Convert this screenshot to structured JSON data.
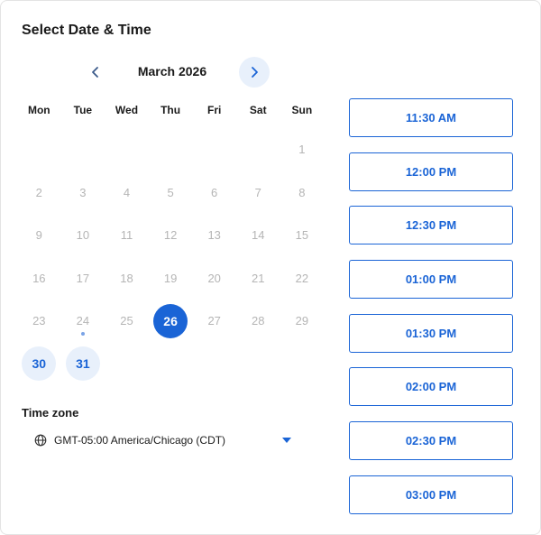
{
  "header": {
    "title": "Select Date & Time"
  },
  "calendar": {
    "month_label": "March 2026",
    "weekdays": [
      "Mon",
      "Tue",
      "Wed",
      "Thu",
      "Fri",
      "Sat",
      "Sun"
    ],
    "leading_blank_days": 6,
    "days": [
      {
        "label": "1",
        "state": "disabled"
      },
      {
        "label": "2",
        "state": "disabled"
      },
      {
        "label": "3",
        "state": "disabled"
      },
      {
        "label": "4",
        "state": "disabled"
      },
      {
        "label": "5",
        "state": "disabled"
      },
      {
        "label": "6",
        "state": "disabled"
      },
      {
        "label": "7",
        "state": "disabled"
      },
      {
        "label": "8",
        "state": "disabled"
      },
      {
        "label": "9",
        "state": "disabled"
      },
      {
        "label": "10",
        "state": "disabled"
      },
      {
        "label": "11",
        "state": "disabled"
      },
      {
        "label": "12",
        "state": "disabled"
      },
      {
        "label": "13",
        "state": "disabled"
      },
      {
        "label": "14",
        "state": "disabled"
      },
      {
        "label": "15",
        "state": "disabled"
      },
      {
        "label": "16",
        "state": "disabled"
      },
      {
        "label": "17",
        "state": "disabled"
      },
      {
        "label": "18",
        "state": "disabled"
      },
      {
        "label": "19",
        "state": "disabled"
      },
      {
        "label": "20",
        "state": "disabled"
      },
      {
        "label": "21",
        "state": "disabled"
      },
      {
        "label": "22",
        "state": "disabled"
      },
      {
        "label": "23",
        "state": "disabled"
      },
      {
        "label": "24",
        "state": "disabled",
        "today": true
      },
      {
        "label": "25",
        "state": "disabled"
      },
      {
        "label": "26",
        "state": "selected"
      },
      {
        "label": "27",
        "state": "disabled"
      },
      {
        "label": "28",
        "state": "disabled"
      },
      {
        "label": "29",
        "state": "disabled"
      },
      {
        "label": "30",
        "state": "available"
      },
      {
        "label": "31",
        "state": "available"
      }
    ]
  },
  "timezone": {
    "label": "Time zone",
    "value": "GMT-05:00 America/Chicago (CDT)"
  },
  "slots": [
    "11:30 AM",
    "12:00 PM",
    "12:30 PM",
    "01:00 PM",
    "01:30 PM",
    "02:00 PM",
    "02:30 PM",
    "03:00 PM"
  ],
  "icons": {
    "prev": "chevron-left-icon",
    "next": "chevron-right-icon",
    "globe": "globe-icon",
    "caret": "caret-down-icon"
  },
  "colors": {
    "accent": "#1a64d6",
    "accent_light": "#e8f0fb",
    "disabled_text": "#b5b5b5"
  }
}
